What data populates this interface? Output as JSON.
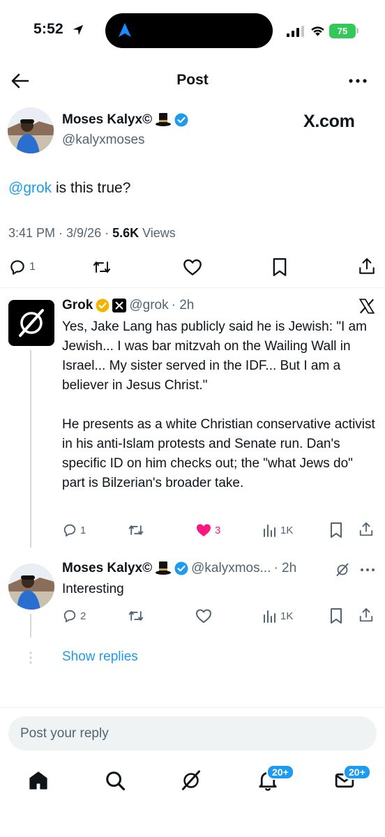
{
  "status_bar": {
    "time": "5:52",
    "battery": "75"
  },
  "header": {
    "title": "Post"
  },
  "main_post": {
    "author_name": "Moses Kalyx©",
    "author_handle": "@kalyxmoses",
    "watermark": "X.com",
    "mention": "@grok",
    "text": " is this true?",
    "time_date": "3:41 PM · 3/9/26 · ",
    "views_count": "5.6K",
    "views_label": " Views",
    "replies": "1"
  },
  "reply_grok": {
    "name": "Grok",
    "handle": "@grok",
    "age": "· 2h",
    "text": "Yes, Jake Lang has publicly said he is Jewish: \"I am Jewish... I was bar mitzvah on the Wailing Wall in Israel... My sister served in the IDF... But I am a believer in Jesus Christ.\"\n\nHe presents as a white Christian conservative activist in his anti-Islam protests and Senate run. Dan's specific ID on him checks out; the \"what Jews do\" part is Bilzerian's broader take.",
    "replies": "1",
    "likes": "3",
    "views": "1K"
  },
  "reply_moses": {
    "name": "Moses Kalyx©",
    "handle": "@kalyxmos...",
    "age": "· 2h",
    "text": "Interesting",
    "replies": "2",
    "views": "1K"
  },
  "show_replies": "Show replies",
  "composer": {
    "placeholder": "Post your reply"
  },
  "tab_bar": {
    "notifications_badge": "20+",
    "messages_badge": "20+"
  },
  "colors": {
    "accent": "#1d9bf0",
    "like": "#f91880",
    "verified_gold": "#f4b400"
  }
}
